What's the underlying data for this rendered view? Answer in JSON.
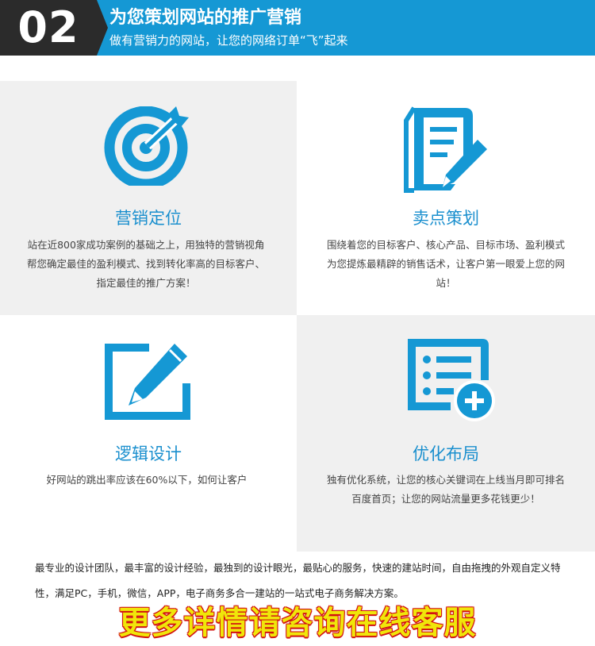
{
  "header": {
    "number": "02",
    "title": "为您策划网站的推广营销",
    "subtitle": "做有营销力的网站，让您的网络订单“飞”起来"
  },
  "features": [
    {
      "icon": "target-icon",
      "title": "营销定位",
      "desc": "站在近800家成功案例的基础之上，用独特的营销视角帮您确定最佳的盈利模式、找到转化率高的目标客户、指定最佳的推广方案！"
    },
    {
      "icon": "document-pen-icon",
      "title": "卖点策划",
      "desc": "围绕着您的目标客户、核心产品、目标市场、盈利模式为您提炼最精辟的销售话术，让客户第一眼爱上您的网站！"
    },
    {
      "icon": "edit-pencil-icon",
      "title": "逻辑设计",
      "desc": "好网站的跳出率应该在60%以下，如何让客户"
    },
    {
      "icon": "list-plus-icon",
      "title": "优化布局",
      "desc": "独有优化系统，让您的核心关键词在上线当月即可排名百度首页；让您的网站流量更多花钱更少！"
    }
  ],
  "footer": {
    "text": "最专业的设计团队，最丰富的设计经验，最独到的设计眼光，最贴心的服务，快速的建站时间，自由拖拽的外观自定义特性，满足PC，手机，微信，APP，电子商务多合一建站的一站式电子商务解决方案。",
    "cta": "更多详情请咨询在线客服"
  },
  "colors": {
    "accent": "#1598d4",
    "header_dark": "#2b2b2b",
    "card_gray": "#f0f0f0",
    "cta_yellow": "#f0e60a",
    "cta_red": "#d21212"
  }
}
